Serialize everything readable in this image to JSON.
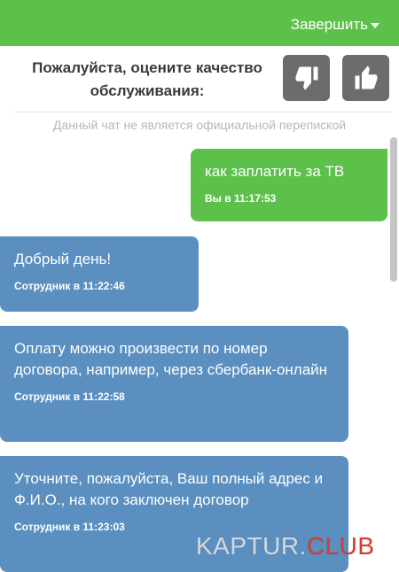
{
  "header": {
    "end_label": "Завершить",
    "bg_color": "#5dc04a"
  },
  "rating": {
    "prompt": "Пожалуйста, оцените качество обслуживания:",
    "thumbs_down_icon": "thumbs-down-icon",
    "thumbs_up_icon": "thumbs-up-icon"
  },
  "notice": "Данный чат не является официальной перепиской",
  "messages": [
    {
      "from": "user",
      "text": "как заплатить за ТВ",
      "meta": "Вы в 11:17:53"
    },
    {
      "from": "agent",
      "text": "Добрый день!",
      "meta": "Сотрудник в 11:22:46"
    },
    {
      "from": "agent",
      "text": "Оплату можно произвести по номер договора, например, через сбербанк-онлайн",
      "meta": "Сотрудник в 11:22:58"
    },
    {
      "from": "agent",
      "text": "Уточните, пожалуйста, Ваш полный адрес и Ф.И.О., на кого заключен договор",
      "meta": "Сотрудник в 11:23:03"
    }
  ],
  "colors": {
    "user_bubble": "#5dc04a",
    "agent_bubble": "#5a8fc0",
    "vote_button": "#6c6c6c"
  },
  "watermark": {
    "main": "KAPTUR.",
    "accent": "CLUB"
  }
}
